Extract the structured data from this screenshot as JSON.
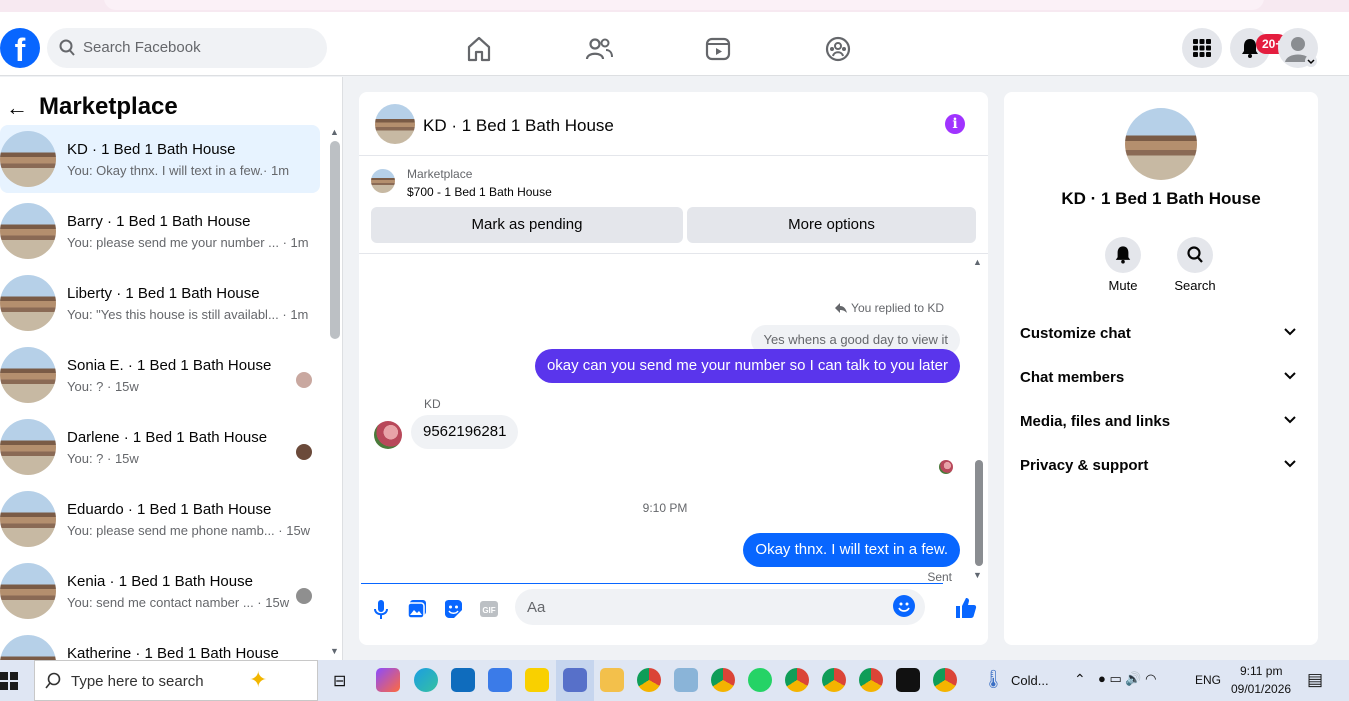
{
  "browser": {
    "url": "web.facebook.com/messages/t/8676908601264010"
  },
  "topbar": {
    "search_placeholder": "Search Facebook",
    "notification_count": "20+"
  },
  "sidebar": {
    "title": "Marketplace",
    "threads": [
      {
        "name": "KD · 1 Bed 1 Bath House",
        "snippet": "You: Okay thnx. I will text in a few.· 1m",
        "active": true
      },
      {
        "name": "Barry · 1 Bed 1 Bath House",
        "snippet": "You: please send me your number ... · 1m"
      },
      {
        "name": "Liberty · 1 Bed 1 Bath House",
        "snippet": "You: \"Yes this house is still availabl... · 1m"
      },
      {
        "name": "Sonia E. · 1 Bed 1 Bath House",
        "snippet": "You: ? · 15w"
      },
      {
        "name": "Darlene · 1 Bed 1 Bath House",
        "snippet": "You: ? · 15w"
      },
      {
        "name": "Eduardo · 1 Bed 1 Bath House",
        "snippet": "You: please send me phone namb... · 15w"
      },
      {
        "name": "Kenia · 1 Bed 1 Bath House",
        "snippet": "You: send me contact namber ... · 15w"
      },
      {
        "name": "Katherine · 1 Bed 1 Bath House",
        "snippet": ""
      }
    ]
  },
  "chat": {
    "title": "KD · 1 Bed 1 Bath House",
    "marketplace_label": "Marketplace",
    "listing": "$700 - 1 Bed 1 Bath House",
    "pending_button": "Mark as pending",
    "more_button": "More options",
    "replied_label": "You replied to KD",
    "reply_quote": "Yes whens a good day to view it",
    "msg_out_1": "okay  can you send me your number so I can talk to you later",
    "sender_name": "KD",
    "msg_in_1": "9562196281",
    "time_separator": "9:10 PM",
    "msg_out_2": "Okay thnx. I will text in a few.",
    "sent_status": "Sent",
    "composer_placeholder": "Aa"
  },
  "right_panel": {
    "name": "KD · 1 Bed 1 Bath House",
    "mute_label": "Mute",
    "search_label": "Search",
    "sections": [
      "Customize chat",
      "Chat members",
      "Media, files and links",
      "Privacy & support"
    ]
  },
  "taskbar": {
    "search_placeholder": "Type here to search",
    "weather": "Cold...",
    "language": "ENG",
    "time": "9:11 pm",
    "date": "09/01/2026"
  },
  "colors": {
    "accent": "#0866ff",
    "purple": "#5a35ec",
    "badge": "#e41e3f"
  }
}
